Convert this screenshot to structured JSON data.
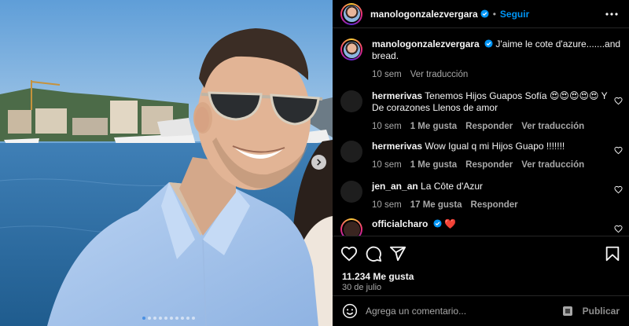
{
  "post": {
    "username": "manologonzalezvergara",
    "follow_label": "Seguir",
    "separator": "•",
    "caption": "J'aime le cote d'azure.......and bread.",
    "caption_time": "10 sem",
    "caption_translate": "Ver traducción"
  },
  "comments": [
    {
      "user": "hermerivas",
      "text": "Tenemos Hijos Guapos Sofía 😍😍😍😍😍 Y De corazones Llenos de amor",
      "time": "10 sem",
      "likes": "1 Me gusta",
      "reply": "Responder",
      "translate": "Ver traducción"
    },
    {
      "user": "hermerivas",
      "text": "Wow Igual q mi Hijos Guapo !!!!!!!",
      "time": "10 sem",
      "likes": "1 Me gusta",
      "reply": "Responder",
      "translate": "Ver traducción"
    },
    {
      "user": "jen_an_an",
      "text": "La Côte d'Azur",
      "time": "10 sem",
      "likes": "17 Me gusta",
      "reply": "Responder",
      "translate": ""
    },
    {
      "user": "officialcharo",
      "text": "❤️",
      "time": "",
      "likes": "",
      "reply": "",
      "translate": ""
    }
  ],
  "actions": {
    "likes": "11.234 Me gusta",
    "date": "30 de julio"
  },
  "add_comment": {
    "placeholder": "Agrega un comentario...",
    "publish_label": "Publicar"
  },
  "carousel": {
    "dot_count": 10,
    "active_index": 0
  },
  "colors": {
    "accent": "#0095f6",
    "background": "#000000",
    "muted": "#a8a8a8",
    "heart": "#ff3040"
  },
  "icons": {
    "verified": "verified-badge-icon",
    "more": "more-options-icon",
    "like": "heart-icon",
    "comment": "comment-icon",
    "share": "share-icon",
    "save": "bookmark-icon",
    "emoji": "emoji-icon",
    "next": "chevron-right-icon"
  }
}
